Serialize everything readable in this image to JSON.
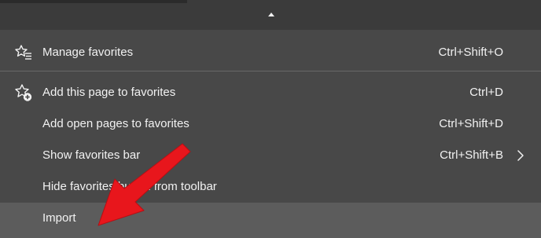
{
  "menu": {
    "items": [
      {
        "label": "Manage favorites",
        "shortcut": "Ctrl+Shift+O",
        "icon": "star-list-icon"
      },
      {
        "label": "Add this page to favorites",
        "shortcut": "Ctrl+D",
        "icon": "star-add-icon"
      },
      {
        "label": "Add open pages to favorites",
        "shortcut": "Ctrl+Shift+D"
      },
      {
        "label": "Show favorites bar",
        "shortcut": "Ctrl+Shift+B",
        "icon": "chevron-right-icon"
      },
      {
        "label": "Hide favorites button from toolbar"
      },
      {
        "label": "Import"
      }
    ]
  },
  "colors": {
    "background": "#3b3b3b",
    "menu_background": "#484848",
    "highlight": "#5c5c5c",
    "text": "#f2f2f2",
    "annotation_arrow": "#e8161c"
  }
}
